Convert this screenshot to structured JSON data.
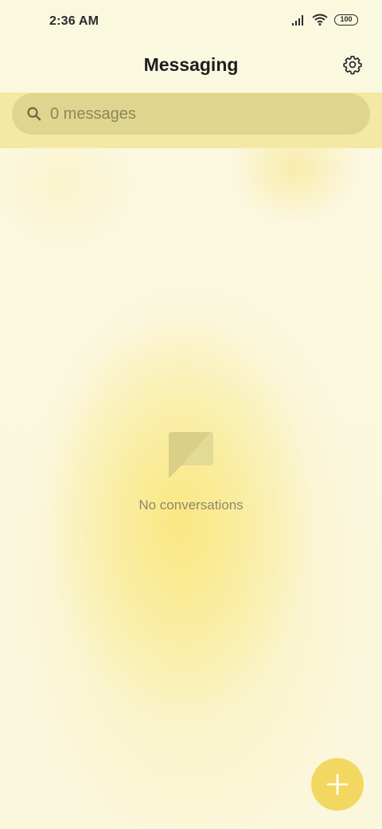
{
  "status_bar": {
    "time": "2:36 AM",
    "battery_level": "100",
    "signal_icon": "signal-bars-icon",
    "wifi_icon": "wifi-icon"
  },
  "header": {
    "title": "Messaging",
    "settings_icon": "gear-icon"
  },
  "search": {
    "placeholder": "0 messages",
    "icon": "search-icon"
  },
  "empty_state": {
    "icon": "chat-bubble-icon",
    "text": "No conversations"
  },
  "fab": {
    "icon": "plus-icon",
    "color": "#f2d861"
  },
  "colors": {
    "background": "#fbf7dc",
    "search_band": "#f4e9a4",
    "search_box": "#dfd58f",
    "accent": "#f2d861"
  }
}
